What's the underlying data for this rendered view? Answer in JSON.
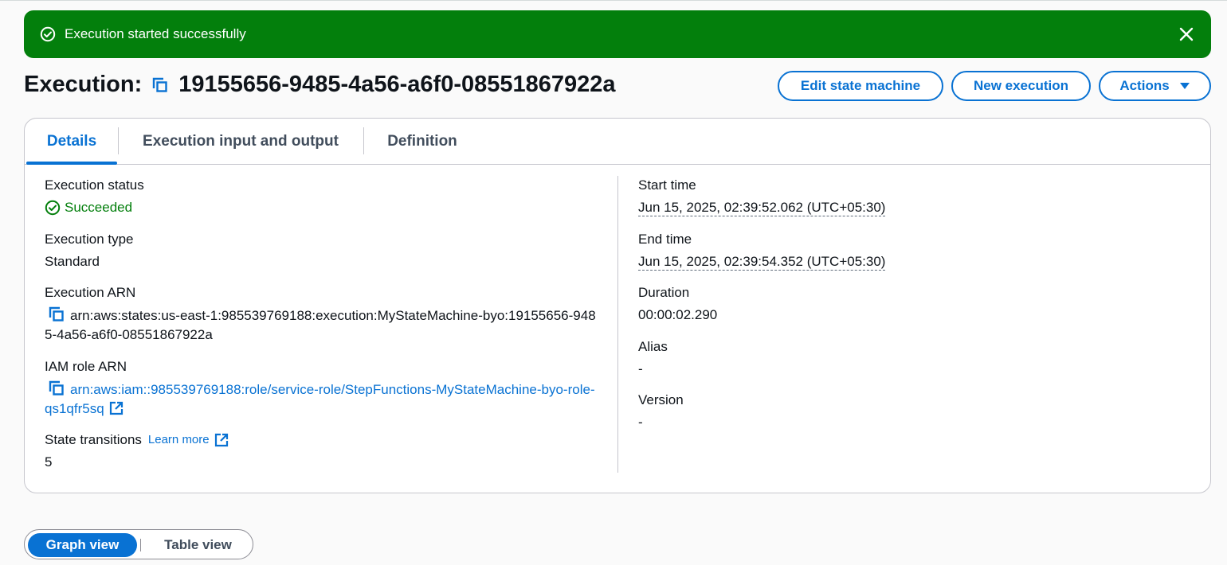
{
  "flash": {
    "message": "Execution started successfully",
    "icon": "check-circle-icon",
    "close_icon": "close-icon",
    "color": "#037f0c"
  },
  "header": {
    "title_prefix": "Execution:",
    "execution_id": "19155656-9485-4a56-a6f0-08551867922a",
    "buttons": {
      "edit": "Edit state machine",
      "new_execution": "New execution",
      "actions": "Actions"
    }
  },
  "tabs": [
    {
      "label": "Details",
      "active": true
    },
    {
      "label": "Execution input and output",
      "active": false
    },
    {
      "label": "Definition",
      "active": false
    }
  ],
  "details": {
    "left": {
      "status_label": "Execution status",
      "status_value": "Succeeded",
      "type_label": "Execution type",
      "type_value": "Standard",
      "arn_label": "Execution ARN",
      "arn_value": "arn:aws:states:us-east-1:985539769188:execution:MyStateMachine-byo:19155656-9485-4a56-a6f0-08551867922a",
      "iam_label": "IAM role ARN",
      "iam_value": "arn:aws:iam::985539769188:role/service-role/StepFunctions-MyStateMachine-byo-role-qs1qfr5sq",
      "transitions_label": "State transitions",
      "learn_more": "Learn more",
      "transitions_value": "5"
    },
    "right": {
      "start_label": "Start time",
      "start_value": "Jun 15, 2025, 02:39:52.062 (UTC+05:30)",
      "end_label": "End time",
      "end_value": "Jun 15, 2025, 02:39:54.352 (UTC+05:30)",
      "duration_label": "Duration",
      "duration_value": "00:00:02.290",
      "alias_label": "Alias",
      "alias_value": "-",
      "version_label": "Version",
      "version_value": "-"
    }
  },
  "view_toggle": {
    "graph": "Graph view",
    "table": "Table view",
    "selected": "Graph view"
  },
  "colors": {
    "accent": "#0972d3",
    "success": "#037f0c"
  }
}
